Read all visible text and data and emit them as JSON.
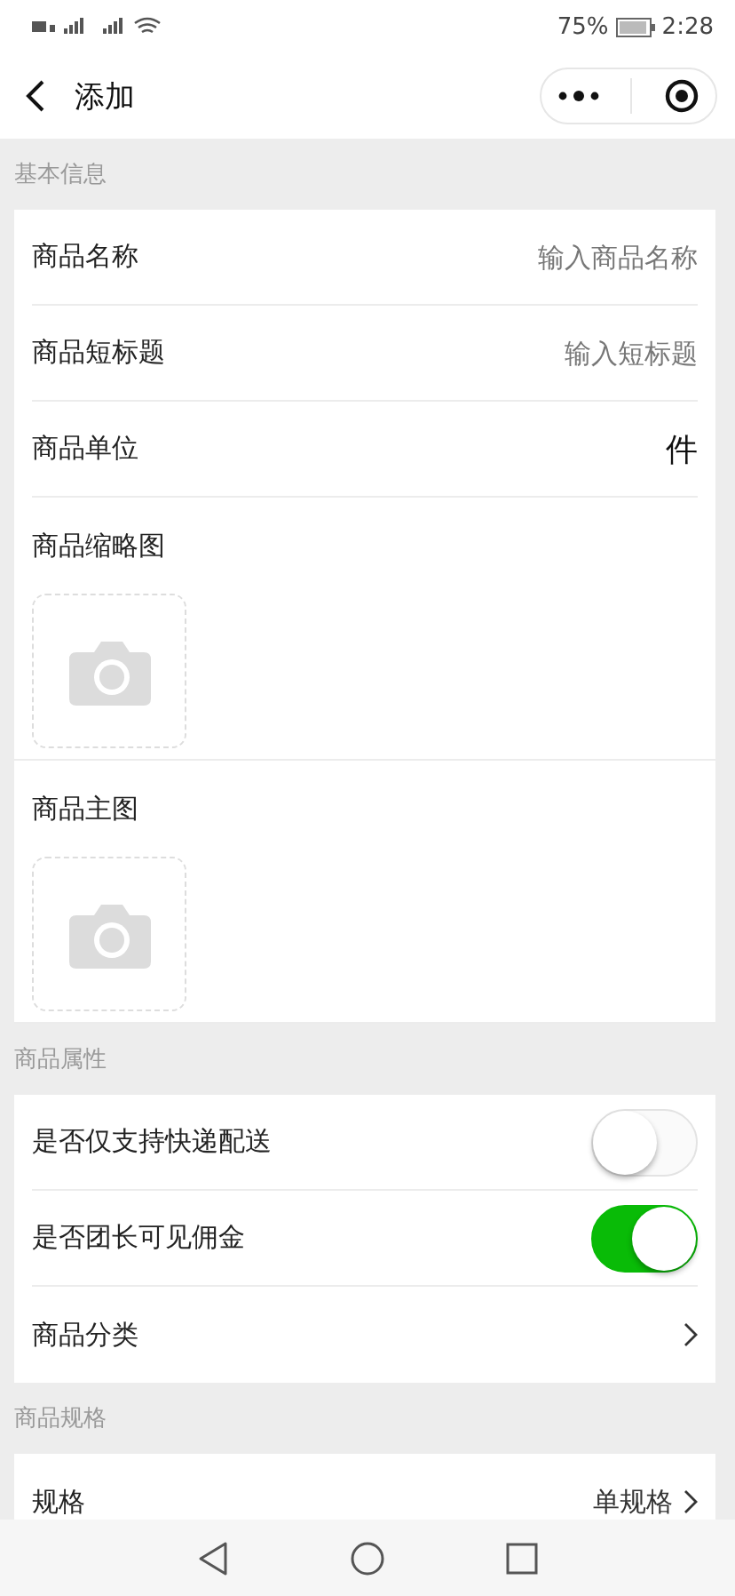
{
  "status_bar": {
    "battery": "75%",
    "time": "2:28"
  },
  "header": {
    "title": "添加"
  },
  "sections": [
    {
      "title": "基本信息",
      "rows": [
        {
          "kind": "input",
          "label": "商品名称",
          "placeholder": "输入商品名称"
        },
        {
          "kind": "input",
          "label": "商品短标题",
          "placeholder": "输入短标题"
        },
        {
          "kind": "value",
          "label": "商品单位",
          "value": "件"
        },
        {
          "kind": "image",
          "label": "商品缩略图"
        },
        {
          "kind": "image",
          "label": "商品主图"
        }
      ]
    },
    {
      "title": "商品属性",
      "rows": [
        {
          "kind": "switch",
          "label": "是否仅支持快递配送",
          "on": false
        },
        {
          "kind": "switch",
          "label": "是否团长可见佣金",
          "on": true
        },
        {
          "kind": "link",
          "label": "商品分类"
        }
      ]
    },
    {
      "title": "商品规格",
      "rows": [
        {
          "kind": "link",
          "label": "规格",
          "value": "单规格"
        }
      ]
    }
  ]
}
